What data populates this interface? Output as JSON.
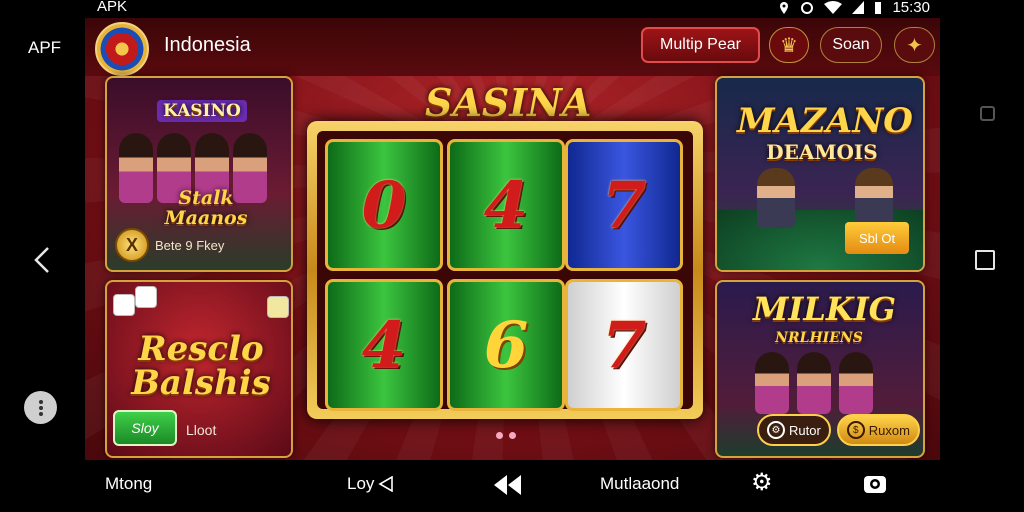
{
  "system": {
    "status_left": "APK",
    "status_time": "15:30",
    "left_rail_label": "APF"
  },
  "header": {
    "region": "Indonesia",
    "primary_button": "Multip Pear",
    "search_button": "Soan"
  },
  "slot": {
    "title": "SASINA",
    "reels_top": [
      "0",
      "4",
      "7"
    ],
    "reels_bottom": [
      "4",
      "6",
      "7"
    ]
  },
  "cards": {
    "kasino": {
      "badge": "KASINO",
      "title": "Stalk Maanos",
      "footer_label": "Bete 9 Fkey"
    },
    "rescue": {
      "title": "Resclo Balshis",
      "button": "Sloy",
      "side_label": "Lloot"
    },
    "mazano": {
      "title": "MAZANO",
      "subtitle": "DEAMOIS",
      "button": "Sbl Ot"
    },
    "milkig": {
      "title": "MILKIG",
      "subtitle": "NRLHIENS",
      "pill_left": "Rutor",
      "pill_right": "Ruxom"
    }
  },
  "bottom_nav": {
    "item1": "Mtong",
    "item2": "Loy",
    "item4": "Mutlaaond"
  },
  "colors": {
    "background": "#7a1016",
    "gold": "#d6a23c",
    "accent_red": "#e24b4b"
  }
}
